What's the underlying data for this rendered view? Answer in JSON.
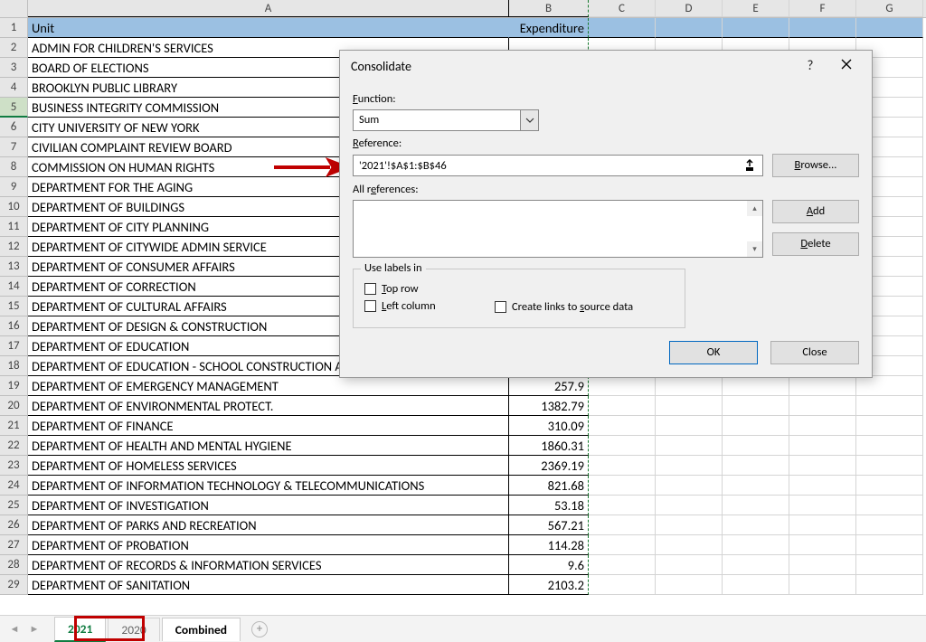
{
  "columns": [
    "A",
    "B",
    "C",
    "D",
    "E",
    "F",
    "G"
  ],
  "header": {
    "A": "Unit",
    "B": "Expenditure"
  },
  "rows": [
    {
      "n": 1
    },
    {
      "n": 2,
      "A": "ADMIN FOR CHILDREN'S SERVICES",
      "B": ""
    },
    {
      "n": 3,
      "A": "BOARD OF ELECTIONS",
      "B": ""
    },
    {
      "n": 4,
      "A": "BROOKLYN PUBLIC LIBRARY",
      "B": ""
    },
    {
      "n": 5,
      "A": "BUSINESS INTEGRITY COMMISSION",
      "B": ""
    },
    {
      "n": 6,
      "A": "CITY UNIVERSITY OF NEW YORK",
      "B": ""
    },
    {
      "n": 7,
      "A": "CIVILIAN COMPLAINT REVIEW BOARD",
      "B": ""
    },
    {
      "n": 8,
      "A": "COMMISSION ON HUMAN RIGHTS",
      "B": ""
    },
    {
      "n": 9,
      "A": "DEPARTMENT FOR THE AGING",
      "B": ""
    },
    {
      "n": 10,
      "A": "DEPARTMENT OF BUILDINGS",
      "B": ""
    },
    {
      "n": 11,
      "A": "DEPARTMENT OF CITY PLANNING",
      "B": ""
    },
    {
      "n": 12,
      "A": "DEPARTMENT OF CITYWIDE ADMIN SERVICE",
      "B": ""
    },
    {
      "n": 13,
      "A": "DEPARTMENT OF CONSUMER AFFAIRS",
      "B": ""
    },
    {
      "n": 14,
      "A": "DEPARTMENT OF CORRECTION",
      "B": ""
    },
    {
      "n": 15,
      "A": "DEPARTMENT OF CULTURAL AFFAIRS",
      "B": ""
    },
    {
      "n": 16,
      "A": "DEPARTMENT OF DESIGN & CONSTRUCTION",
      "B": ""
    },
    {
      "n": 17,
      "A": "DEPARTMENT OF EDUCATION",
      "B": ""
    },
    {
      "n": 18,
      "A": "DEPARTMENT OF EDUCATION - SCHOOL CONSTRUCTION AUTHORITY",
      "B": ""
    },
    {
      "n": 19,
      "A": "DEPARTMENT OF EMERGENCY MANAGEMENT",
      "B": "257.9"
    },
    {
      "n": 20,
      "A": "DEPARTMENT OF ENVIRONMENTAL PROTECT.",
      "B": "1382.79"
    },
    {
      "n": 21,
      "A": "DEPARTMENT OF FINANCE",
      "B": "310.09"
    },
    {
      "n": 22,
      "A": "DEPARTMENT OF HEALTH AND MENTAL HYGIENE",
      "B": "1860.31"
    },
    {
      "n": 23,
      "A": "DEPARTMENT OF HOMELESS SERVICES",
      "B": "2369.19"
    },
    {
      "n": 24,
      "A": "DEPARTMENT OF INFORMATION TECHNOLOGY & TELECOMMUNICATIONS",
      "B": "821.68"
    },
    {
      "n": 25,
      "A": "DEPARTMENT OF INVESTIGATION",
      "B": "53.18"
    },
    {
      "n": 26,
      "A": "DEPARTMENT OF PARKS AND RECREATION",
      "B": "567.21"
    },
    {
      "n": 27,
      "A": "DEPARTMENT OF PROBATION",
      "B": "114.28"
    },
    {
      "n": 28,
      "A": "DEPARTMENT OF RECORDS & INFORMATION SERVICES",
      "B": "9.6"
    },
    {
      "n": 29,
      "A": "DEPARTMENT OF SANITATION",
      "B": "2103.2"
    }
  ],
  "dialog": {
    "title": "Consolidate",
    "function_label": "Function:",
    "function_value": "Sum",
    "reference_label": "Reference:",
    "reference_value": "'2021'!$A$1:$B$46",
    "browse": "Browse...",
    "allrefs_label": "All references:",
    "add": "Add",
    "delete": "Delete",
    "group_title": "Use labels in",
    "top_row": "Top row",
    "left_column": "Left column",
    "create_links": "Create links to source data",
    "ok": "OK",
    "close": "Close"
  },
  "tabs": {
    "t1": "2021",
    "t2": "2020",
    "t3": "Combined"
  }
}
